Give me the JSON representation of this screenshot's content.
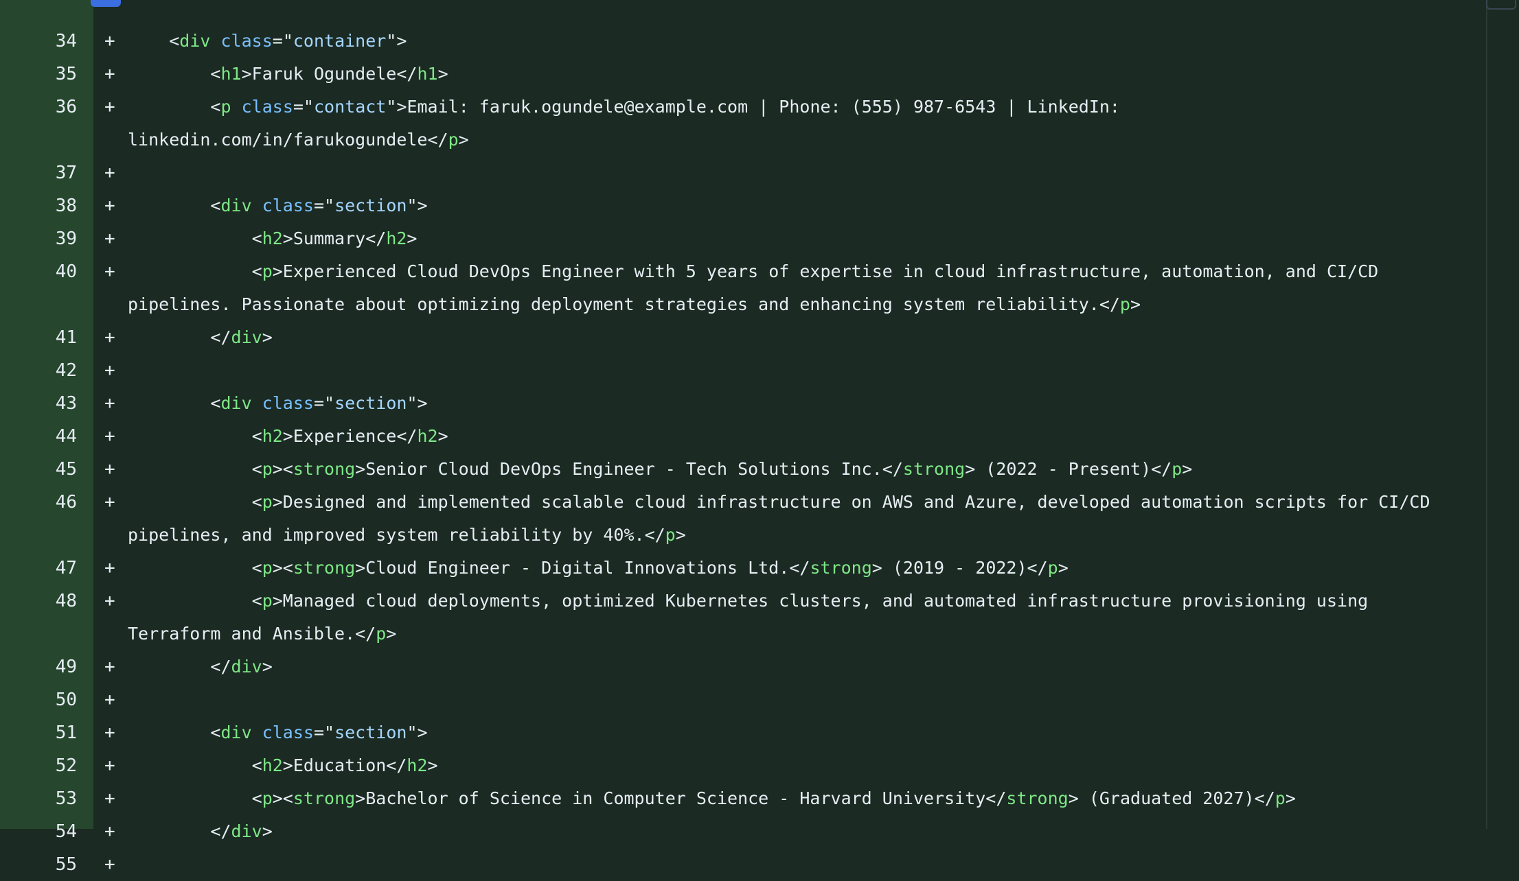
{
  "diff": {
    "lines": [
      {
        "number": "34",
        "sign": "+",
        "indent": "    ",
        "tokens": [
          [
            "p",
            "<"
          ],
          [
            "t",
            "div"
          ],
          [
            "p",
            " "
          ],
          [
            "a",
            "class"
          ],
          [
            "p",
            "=\""
          ],
          [
            "s",
            "container"
          ],
          [
            "p",
            "\">"
          ]
        ]
      },
      {
        "number": "35",
        "sign": "+",
        "indent": "        ",
        "tokens": [
          [
            "p",
            "<"
          ],
          [
            "t",
            "h1"
          ],
          [
            "p",
            ">Faruk Ogundele</"
          ],
          [
            "t",
            "h1"
          ],
          [
            "p",
            ">"
          ]
        ]
      },
      {
        "number": "36",
        "sign": "+",
        "indent": "        ",
        "tokens": [
          [
            "p",
            "<"
          ],
          [
            "t",
            "p"
          ],
          [
            "p",
            " "
          ],
          [
            "a",
            "class"
          ],
          [
            "p",
            "=\""
          ],
          [
            "s",
            "contact"
          ],
          [
            "p",
            "\">Email: faruk.ogundele@example.com | Phone: (555) 987-6543 | LinkedIn: linkedin.com/in/farukogundele</"
          ],
          [
            "t",
            "p"
          ],
          [
            "p",
            ">"
          ]
        ]
      },
      {
        "number": "37",
        "sign": "+",
        "indent": "",
        "tokens": []
      },
      {
        "number": "38",
        "sign": "+",
        "indent": "        ",
        "tokens": [
          [
            "p",
            "<"
          ],
          [
            "t",
            "div"
          ],
          [
            "p",
            " "
          ],
          [
            "a",
            "class"
          ],
          [
            "p",
            "=\""
          ],
          [
            "s",
            "section"
          ],
          [
            "p",
            "\">"
          ]
        ]
      },
      {
        "number": "39",
        "sign": "+",
        "indent": "            ",
        "tokens": [
          [
            "p",
            "<"
          ],
          [
            "t",
            "h2"
          ],
          [
            "p",
            ">Summary</"
          ],
          [
            "t",
            "h2"
          ],
          [
            "p",
            ">"
          ]
        ]
      },
      {
        "number": "40",
        "sign": "+",
        "indent": "            ",
        "tokens": [
          [
            "p",
            "<"
          ],
          [
            "t",
            "p"
          ],
          [
            "p",
            ">Experienced Cloud DevOps Engineer with 5 years of expertise in cloud infrastructure, automation, and CI/CD pipelines. Passionate about optimizing deployment strategies and enhancing system reliability.</"
          ],
          [
            "t",
            "p"
          ],
          [
            "p",
            ">"
          ]
        ]
      },
      {
        "number": "41",
        "sign": "+",
        "indent": "        ",
        "tokens": [
          [
            "p",
            "</"
          ],
          [
            "t",
            "div"
          ],
          [
            "p",
            ">"
          ]
        ]
      },
      {
        "number": "42",
        "sign": "+",
        "indent": "",
        "tokens": []
      },
      {
        "number": "43",
        "sign": "+",
        "indent": "        ",
        "tokens": [
          [
            "p",
            "<"
          ],
          [
            "t",
            "div"
          ],
          [
            "p",
            " "
          ],
          [
            "a",
            "class"
          ],
          [
            "p",
            "=\""
          ],
          [
            "s",
            "section"
          ],
          [
            "p",
            "\">"
          ]
        ]
      },
      {
        "number": "44",
        "sign": "+",
        "indent": "            ",
        "tokens": [
          [
            "p",
            "<"
          ],
          [
            "t",
            "h2"
          ],
          [
            "p",
            ">Experience</"
          ],
          [
            "t",
            "h2"
          ],
          [
            "p",
            ">"
          ]
        ]
      },
      {
        "number": "45",
        "sign": "+",
        "indent": "            ",
        "tokens": [
          [
            "p",
            "<"
          ],
          [
            "t",
            "p"
          ],
          [
            "p",
            "><"
          ],
          [
            "t",
            "strong"
          ],
          [
            "p",
            ">Senior Cloud DevOps Engineer - Tech Solutions Inc.</"
          ],
          [
            "t",
            "strong"
          ],
          [
            "p",
            "> (2022 - Present)</"
          ],
          [
            "t",
            "p"
          ],
          [
            "p",
            ">"
          ]
        ]
      },
      {
        "number": "46",
        "sign": "+",
        "indent": "            ",
        "tokens": [
          [
            "p",
            "<"
          ],
          [
            "t",
            "p"
          ],
          [
            "p",
            ">Designed and implemented scalable cloud infrastructure on AWS and Azure, developed automation scripts for CI/CD pipelines, and improved system reliability by 40%.</"
          ],
          [
            "t",
            "p"
          ],
          [
            "p",
            ">"
          ]
        ]
      },
      {
        "number": "47",
        "sign": "+",
        "indent": "            ",
        "tokens": [
          [
            "p",
            "<"
          ],
          [
            "t",
            "p"
          ],
          [
            "p",
            "><"
          ],
          [
            "t",
            "strong"
          ],
          [
            "p",
            ">Cloud Engineer - Digital Innovations Ltd.</"
          ],
          [
            "t",
            "strong"
          ],
          [
            "p",
            "> (2019 - 2022)</"
          ],
          [
            "t",
            "p"
          ],
          [
            "p",
            ">"
          ]
        ]
      },
      {
        "number": "48",
        "sign": "+",
        "indent": "            ",
        "tokens": [
          [
            "p",
            "<"
          ],
          [
            "t",
            "p"
          ],
          [
            "p",
            ">Managed cloud deployments, optimized Kubernetes clusters, and automated infrastructure provisioning using Terraform and Ansible.</"
          ],
          [
            "t",
            "p"
          ],
          [
            "p",
            ">"
          ]
        ]
      },
      {
        "number": "49",
        "sign": "+",
        "indent": "        ",
        "tokens": [
          [
            "p",
            "</"
          ],
          [
            "t",
            "div"
          ],
          [
            "p",
            ">"
          ]
        ]
      },
      {
        "number": "50",
        "sign": "+",
        "indent": "",
        "tokens": []
      },
      {
        "number": "51",
        "sign": "+",
        "indent": "        ",
        "tokens": [
          [
            "p",
            "<"
          ],
          [
            "t",
            "div"
          ],
          [
            "p",
            " "
          ],
          [
            "a",
            "class"
          ],
          [
            "p",
            "=\""
          ],
          [
            "s",
            "section"
          ],
          [
            "p",
            "\">"
          ]
        ]
      },
      {
        "number": "52",
        "sign": "+",
        "indent": "            ",
        "tokens": [
          [
            "p",
            "<"
          ],
          [
            "t",
            "h2"
          ],
          [
            "p",
            ">Education</"
          ],
          [
            "t",
            "h2"
          ],
          [
            "p",
            ">"
          ]
        ]
      },
      {
        "number": "53",
        "sign": "+",
        "indent": "            ",
        "tokens": [
          [
            "p",
            "<"
          ],
          [
            "t",
            "p"
          ],
          [
            "p",
            "><"
          ],
          [
            "t",
            "strong"
          ],
          [
            "p",
            ">Bachelor of Science in Computer Science - Harvard University</"
          ],
          [
            "t",
            "strong"
          ],
          [
            "p",
            "> (Graduated 2027)</"
          ],
          [
            "t",
            "p"
          ],
          [
            "p",
            ">"
          ]
        ]
      },
      {
        "number": "54",
        "sign": "+",
        "indent": "        ",
        "tokens": [
          [
            "p",
            "</"
          ],
          [
            "t",
            "div"
          ],
          [
            "p",
            ">"
          ]
        ]
      },
      {
        "number": "55",
        "sign": "+",
        "indent": "",
        "tokens": []
      }
    ]
  },
  "colors": {
    "gutter_bg": "#26472e",
    "code_bg": "#1b2a22",
    "text": "#e6edf3",
    "tag": "#7ee787",
    "attr": "#79c0ff",
    "string": "#a5d6ff"
  }
}
